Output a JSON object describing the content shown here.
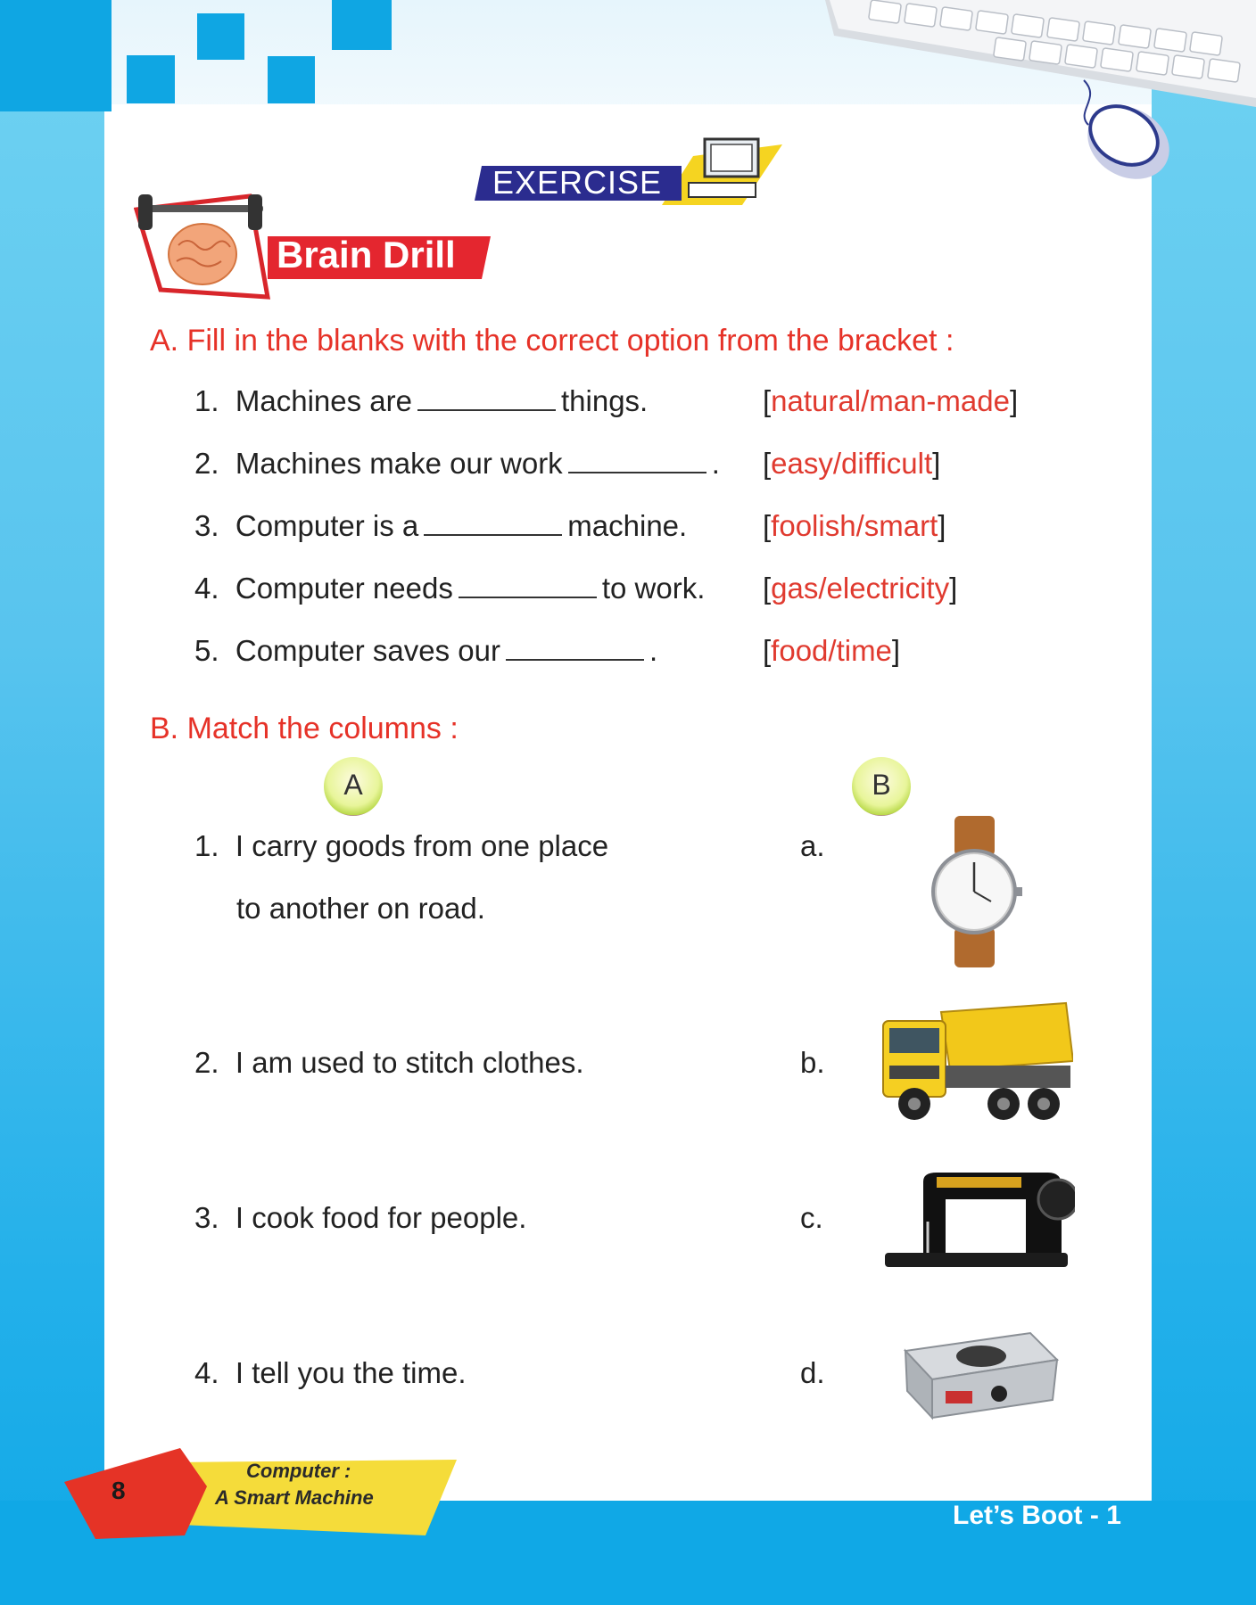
{
  "header": {
    "exercise_label": "EXERCISE",
    "brain_drill_label": "Brain Drill"
  },
  "sectionA": {
    "title": "A.  Fill in the blanks with the correct option from the bracket :",
    "items": [
      {
        "num": "1.",
        "before": "Machines are",
        "after": "things.",
        "option": "natural/man-made"
      },
      {
        "num": "2.",
        "before": "Machines make our work",
        "after": ".",
        "option": "easy/difficult"
      },
      {
        "num": "3.",
        "before": "Computer is a",
        "after": "machine.",
        "option": "foolish/smart"
      },
      {
        "num": "4.",
        "before": "Computer needs",
        "after": "to work.",
        "option": "gas/electricity"
      },
      {
        "num": "5.",
        "before": "Computer saves our",
        "after": ".",
        "option": "food/time"
      }
    ]
  },
  "sectionB": {
    "title": "B.  Match the columns :",
    "colA": "A",
    "colB": "B",
    "items": [
      {
        "num": "1.",
        "line1": "I carry goods from one place",
        "line2": "to another on road.",
        "letter": "a."
      },
      {
        "num": "2.",
        "line1": "I am used to stitch clothes.",
        "letter": "b."
      },
      {
        "num": "3.",
        "line1": "I cook food for people.",
        "letter": "c."
      },
      {
        "num": "4.",
        "line1": "I tell you the time.",
        "letter": "d."
      }
    ],
    "images": [
      "watch-image",
      "truck-image",
      "sewing-machine-image",
      "gas-stove-image"
    ]
  },
  "footer": {
    "page_number": "8",
    "chapter_line1": "Computer :",
    "chapter_line2": "A Smart Machine",
    "book_title": "Let’s Boot - 1"
  }
}
